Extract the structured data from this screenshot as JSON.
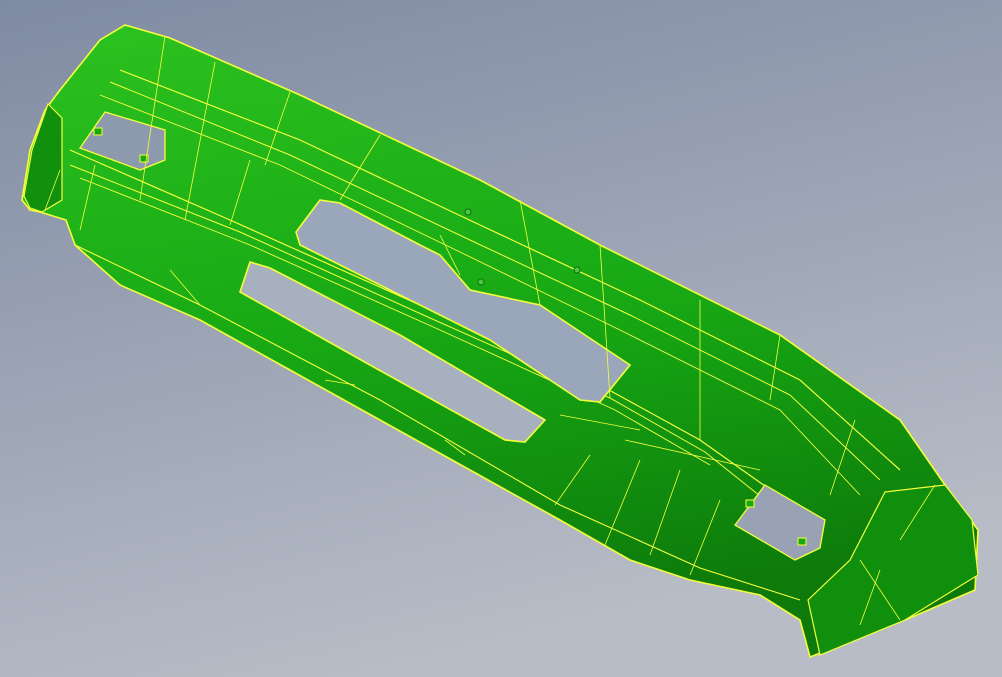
{
  "viewport": {
    "background_top": "#7f8ba3",
    "background_bottom": "#b7bcc6"
  },
  "model": {
    "part_name": "bumper",
    "face_color": "#17a814",
    "face_color_light": "#2cc21f",
    "face_color_dark": "#0d7a0a",
    "edge_color": "#f4ff3c"
  }
}
